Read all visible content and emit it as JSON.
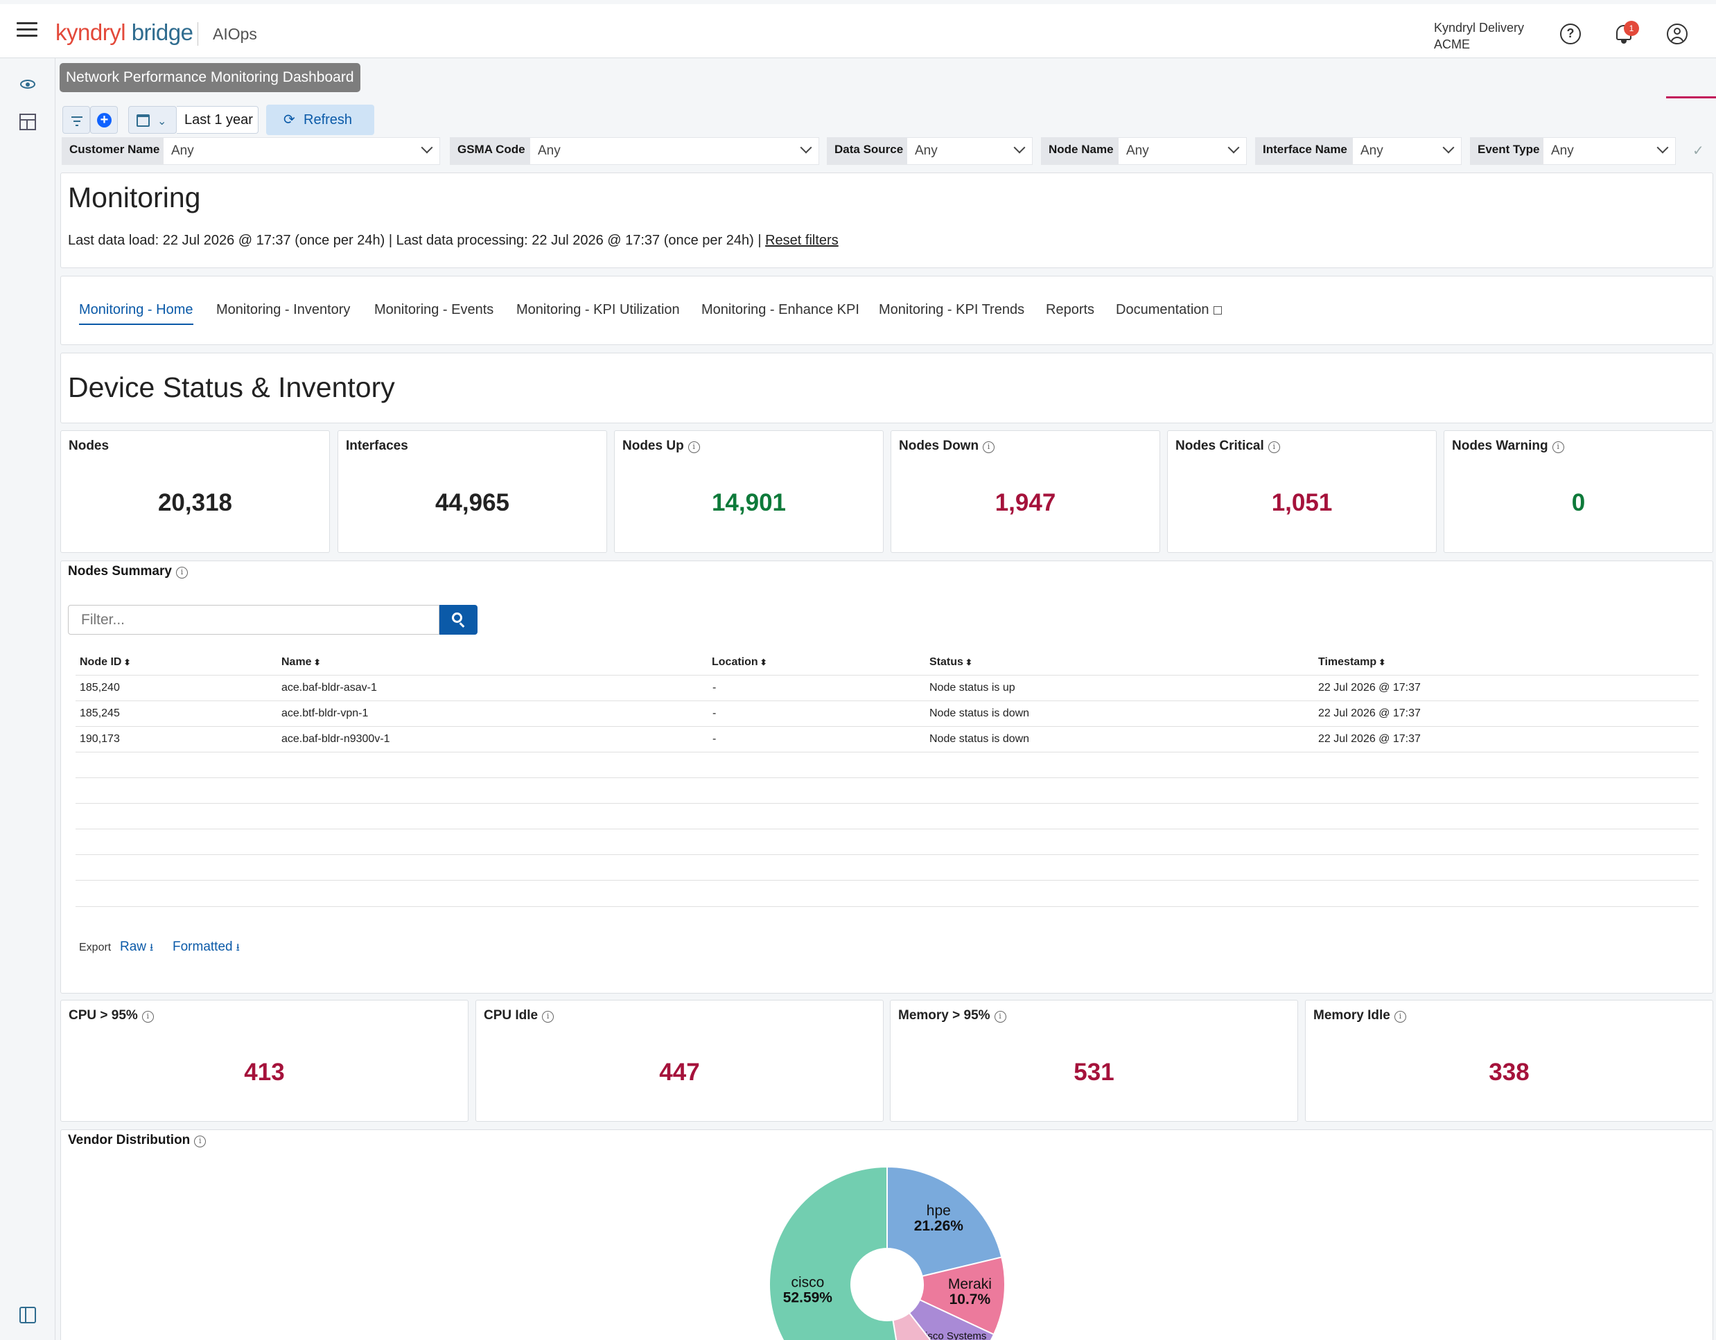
{
  "header": {
    "logo_kyndryl": "kyndryl",
    "logo_bridge": "bridge",
    "app_name": "AIOps",
    "delivery_line1": "Kyndryl Delivery",
    "delivery_line2": "ACME",
    "notification_count": "1"
  },
  "dashboard_title": "Network Performance Monitoring Dashboard",
  "toolbar": {
    "period": "Last 1 year",
    "refresh_label": "Refresh"
  },
  "filters": [
    {
      "label": "Customer Name",
      "value": "Any"
    },
    {
      "label": "GSMA Code",
      "value": "Any"
    },
    {
      "label": "Data Source",
      "value": "Any"
    },
    {
      "label": "Node Name",
      "value": "Any"
    },
    {
      "label": "Interface Name",
      "value": "Any"
    },
    {
      "label": "Event Type",
      "value": "Any"
    }
  ],
  "monitoring": {
    "title": "Monitoring",
    "load_text": "Last data load: 22 Jul 2026 @ 17:37 (once per 24h) | Last data processing: 22 Jul 2026 @ 17:37 (once per 24h) |",
    "reset_filters": "Reset filters"
  },
  "tabs": [
    "Monitoring - Home",
    "Monitoring - Inventory",
    "Monitoring - Events",
    "Monitoring - KPI Utilization",
    "Monitoring - Enhance KPI",
    "Monitoring - KPI Trends",
    "Reports",
    "Documentation"
  ],
  "section_title": "Device Status & Inventory",
  "kpis": [
    {
      "label": "Nodes",
      "value": "20,318",
      "color": "#222222"
    },
    {
      "label": "Interfaces",
      "value": "44,965",
      "color": "#222222"
    },
    {
      "label": "Nodes Up",
      "value": "14,901",
      "color": "#0e7a3a"
    },
    {
      "label": "Nodes Down",
      "value": "1,947",
      "color": "#a5123b"
    },
    {
      "label": "Nodes Critical",
      "value": "1,051",
      "color": "#a5123b"
    },
    {
      "label": "Nodes Warning",
      "value": "0",
      "color": "#0e7a3a"
    }
  ],
  "nodes_summary": {
    "title": "Nodes Summary",
    "filter_placeholder": "Filter...",
    "columns": [
      "Node ID",
      "Name",
      "Location",
      "Status",
      "Timestamp"
    ],
    "rows": [
      [
        "185,240",
        "ace.baf-bldr-asav-1",
        "-",
        "Node status is up",
        "22 Jul 2026 @ 17:37"
      ],
      [
        "185,245",
        "ace.btf-bldr-vpn-1",
        "-",
        "Node status is down",
        "22 Jul 2026 @ 17:37"
      ],
      [
        "190,173",
        "ace.baf-bldr-n9300v-1",
        "-",
        "Node status is down",
        "22 Jul 2026 @ 17:37"
      ]
    ],
    "export_label": "Export",
    "raw_label": "Raw",
    "formatted_label": "Formatted"
  },
  "resource_kpis": [
    {
      "label": "CPU > 95%",
      "value": "413"
    },
    {
      "label": "CPU Idle",
      "value": "447"
    },
    {
      "label": "Memory > 95%",
      "value": "531"
    },
    {
      "label": "Memory Idle",
      "value": "338"
    }
  ],
  "vendor_distribution": {
    "title": "Vendor Distribution"
  },
  "chart_data": {
    "type": "pie",
    "donut": true,
    "slices": [
      {
        "name": "hpe",
        "value": 21.26,
        "label": "21.26%",
        "color": "#7aaadc"
      },
      {
        "name": "Meraki",
        "value": 10.7,
        "label": "10.7%",
        "color": "#ec7a9c"
      },
      {
        "name": "Cisco Systems",
        "value": 7.5,
        "label": "",
        "color": "#a98ad6"
      },
      {
        "name": "",
        "value": 7.95,
        "label": "",
        "color": "#f1b7cb"
      },
      {
        "name": "cisco",
        "value": 52.59,
        "label": "52.59%",
        "color": "#72ceb0"
      }
    ]
  }
}
